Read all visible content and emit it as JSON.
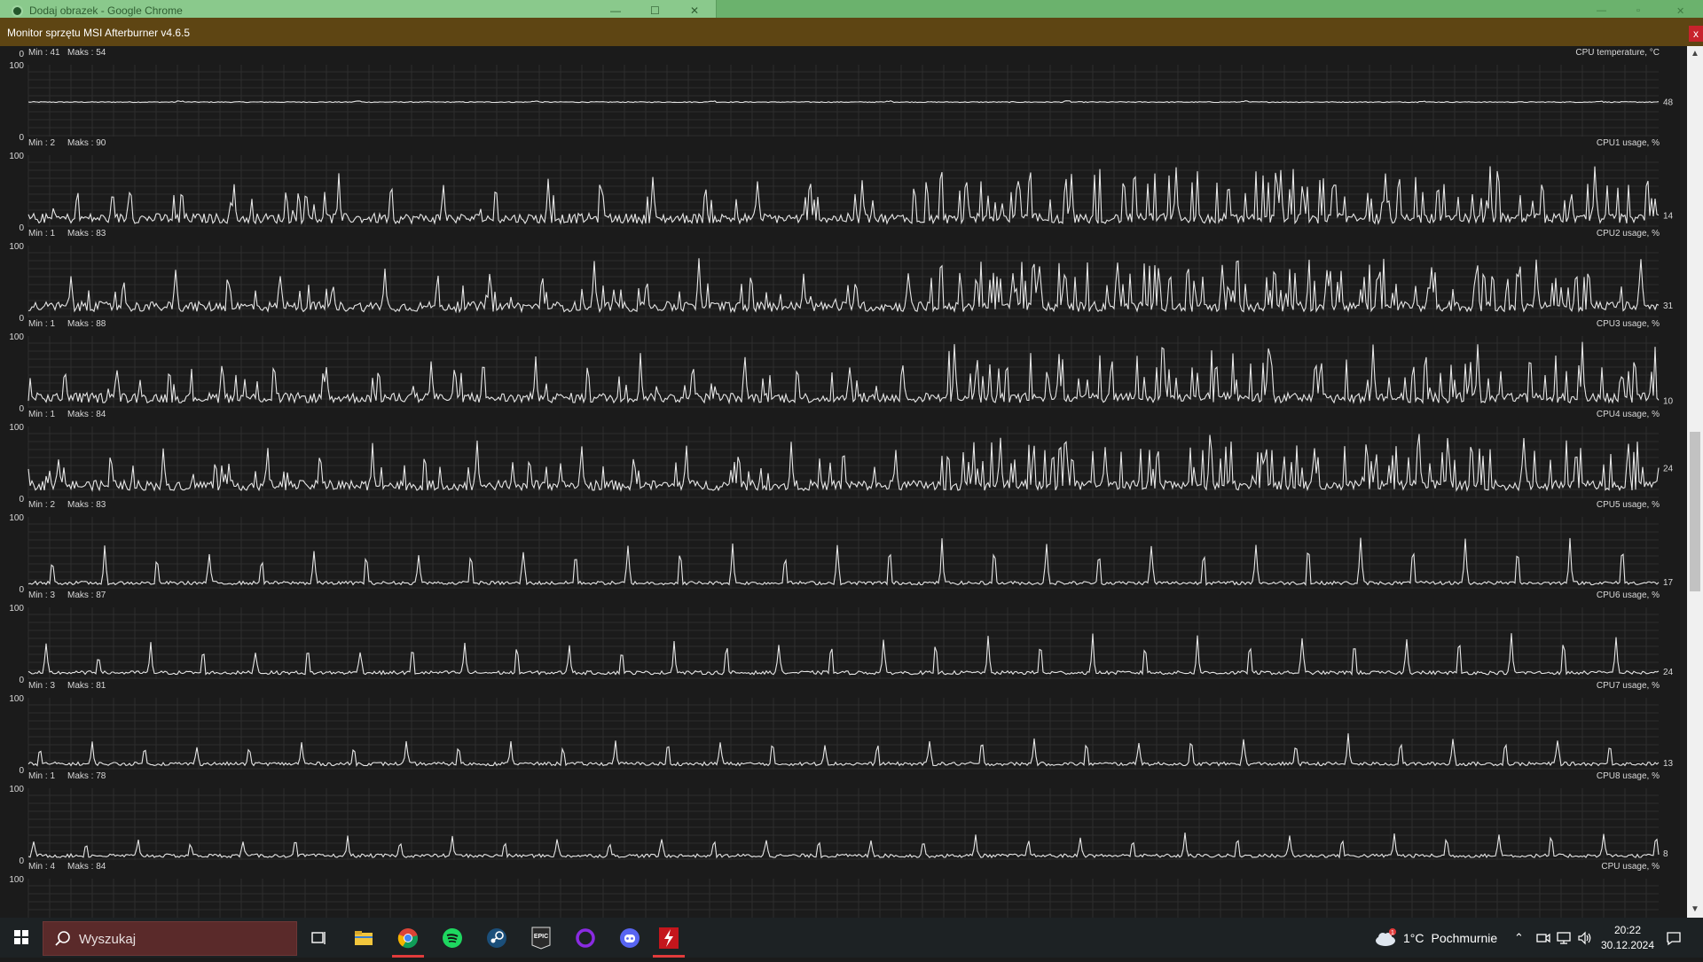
{
  "background_window": {
    "title": "Dodaj obrazek - Google Chrome"
  },
  "window": {
    "title": "Monitor sprzętu MSI Afterburner v4.6.5",
    "close_label": "x"
  },
  "graphs": [
    {
      "name": "CPU temperature, °C",
      "min_label": "Min : 41",
      "max_label": "Maks : 54",
      "axis_top": "100",
      "axis_bottom": "0",
      "current": "48",
      "kind": "temp",
      "level": 48,
      "spike_scale": 0
    },
    {
      "name": "CPU1 usage, %",
      "min_label": "Min : 2",
      "max_label": "Maks : 90",
      "axis_top": "100",
      "axis_bottom": "0",
      "current": "14",
      "kind": "usage",
      "level": 12,
      "spike_scale": 1.0
    },
    {
      "name": "CPU2 usage, %",
      "min_label": "Min : 1",
      "max_label": "Maks : 83",
      "axis_top": "100",
      "axis_bottom": "0",
      "current": "31",
      "kind": "usage",
      "level": 15,
      "spike_scale": 0.95
    },
    {
      "name": "CPU3 usage, %",
      "min_label": "Min : 1",
      "max_label": "Maks : 88",
      "axis_top": "100",
      "axis_bottom": "0",
      "current": "10",
      "kind": "usage",
      "level": 14,
      "spike_scale": 1.0
    },
    {
      "name": "CPU4 usage, %",
      "min_label": "Min : 1",
      "max_label": "Maks : 84",
      "axis_top": "100",
      "axis_bottom": "0",
      "current": "24",
      "kind": "usage",
      "level": 18,
      "spike_scale": 0.95
    },
    {
      "name": "CPU5 usage, %",
      "min_label": "Min : 2",
      "max_label": "Maks : 83",
      "axis_top": "100",
      "axis_bottom": "0",
      "current": "17",
      "kind": "periodic",
      "level": 8,
      "spike_scale": 0.9
    },
    {
      "name": "CPU6 usage, %",
      "min_label": "Min : 3",
      "max_label": "Maks : 87",
      "axis_top": "100",
      "axis_bottom": "0",
      "current": "24",
      "kind": "periodic",
      "level": 9,
      "spike_scale": 0.75
    },
    {
      "name": "CPU7 usage, %",
      "min_label": "Min : 3",
      "max_label": "Maks : 81",
      "axis_top": "100",
      "axis_bottom": "0",
      "current": "13",
      "kind": "periodic",
      "level": 8,
      "spike_scale": 0.55
    },
    {
      "name": "CPU8 usage, %",
      "min_label": "Min : 1",
      "max_label": "Maks : 78",
      "axis_top": "100",
      "axis_bottom": "0",
      "current": "8",
      "kind": "periodic",
      "level": 6,
      "spike_scale": 0.45
    },
    {
      "name": "CPU usage, %",
      "min_label": "Min : 4",
      "max_label": "Maks : 84",
      "axis_top": "100",
      "axis_bottom": "0",
      "current": "",
      "kind": "partial",
      "level": 0,
      "spike_scale": 0
    }
  ],
  "colors": {
    "graph_line": "#e6e6e6",
    "grid": "#2e2e2e",
    "titlebar": "#5e4513",
    "taskbar": "#1d2224",
    "search_bg": "#5a2a2a"
  },
  "taskbar": {
    "search_placeholder": "Wyszukaj",
    "apps": [
      "task-view-icon",
      "file-explorer-icon",
      "chrome-icon",
      "spotify-icon",
      "steam-icon",
      "epic-games-icon",
      "cortana-icon",
      "discord-icon",
      "afterburner-icon"
    ],
    "weather_temp": "1°C",
    "weather_text": "Pochmurnie",
    "weather_badge": "1",
    "time": "20:22",
    "date": "30.12.2024"
  }
}
